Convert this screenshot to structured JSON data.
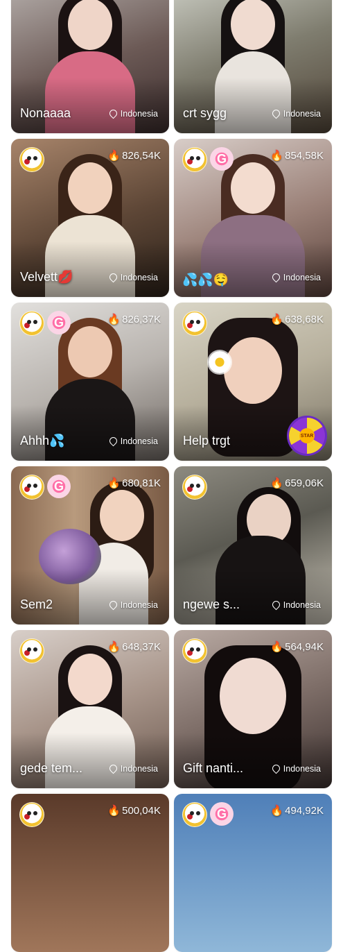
{
  "accent": {
    "fire": "#ff5a1f",
    "swirl": "#ff6fa8"
  },
  "cards": [
    {
      "title": "Nonaaaa",
      "viewers": "",
      "location": "Indonesia",
      "badges": []
    },
    {
      "title": "crt sygg",
      "viewers": "",
      "location": "Indonesia",
      "badges": []
    },
    {
      "title": "Velvett",
      "title_emoji": "💋",
      "viewers": "826,54K",
      "location": "Indonesia",
      "badges": [
        "face-badge"
      ]
    },
    {
      "title": "",
      "title_emoji": "💦💦🤤",
      "viewers": "854,58K",
      "location": "Indonesia",
      "badges": [
        "face-badge",
        "swirl-badge"
      ]
    },
    {
      "title": "Ahhh",
      "title_emoji": "💦",
      "viewers": "826,37K",
      "location": "Indonesia",
      "badges": [
        "face-badge",
        "swirl-badge"
      ]
    },
    {
      "title": "Help trgt",
      "viewers": "638,68K",
      "location": "",
      "badges": [
        "face-badge"
      ],
      "extra": "wheel",
      "wheel_label": "STAR"
    },
    {
      "title": "Sem2",
      "viewers": "680,81K",
      "location": "Indonesia",
      "badges": [
        "face-badge",
        "swirl-badge"
      ]
    },
    {
      "title": "ngewe s...",
      "viewers": "659,06K",
      "location": "Indonesia",
      "badges": [
        "face-badge"
      ]
    },
    {
      "title": "gede tem...",
      "viewers": "648,37K",
      "location": "Indonesia",
      "badges": [
        "face-badge"
      ]
    },
    {
      "title": "Gift nanti...",
      "viewers": "564,94K",
      "location": "Indonesia",
      "badges": [
        "face-badge"
      ]
    },
    {
      "title": "",
      "viewers": "500,04K",
      "location": "",
      "badges": [
        "face-badge"
      ]
    },
    {
      "title": "",
      "viewers": "494,92K",
      "location": "",
      "badges": [
        "face-badge",
        "swirl-badge"
      ]
    }
  ]
}
